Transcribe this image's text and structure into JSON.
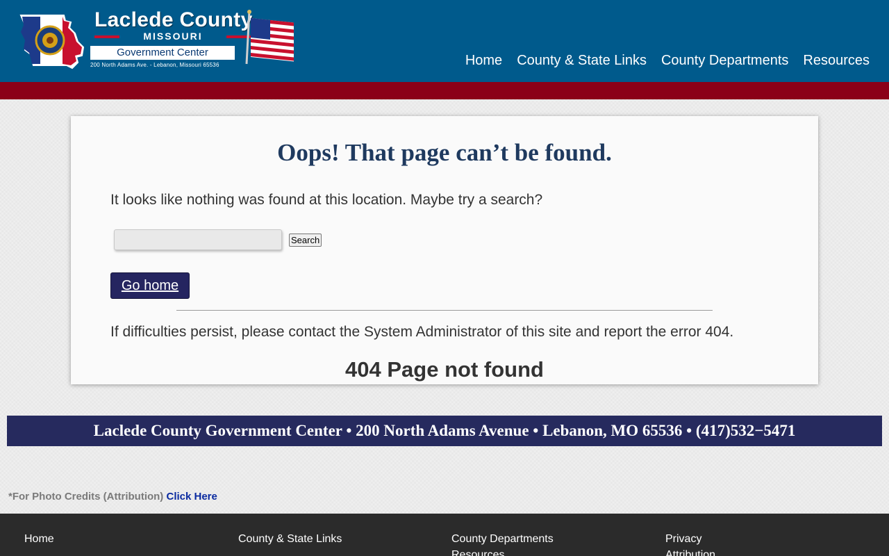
{
  "header": {
    "logo": {
      "title": "Laclede County",
      "state": "MISSOURI",
      "subtitle": "Government Center",
      "address": "200 North Adams Ave. - Lebanon, Missouri 65536"
    },
    "nav": [
      {
        "label": "Home"
      },
      {
        "label": "County & State Links"
      },
      {
        "label": "County Departments"
      },
      {
        "label": "Resources"
      }
    ],
    "colors": {
      "header_bg": "#005a8c",
      "band": "#8b0018"
    }
  },
  "main": {
    "title": "Oops! That page can’t be found.",
    "lead": "It looks like nothing was found at this location. Maybe try a search?",
    "search": {
      "placeholder": "",
      "value": "",
      "button_label": "Search"
    },
    "go_home_label": "Go home",
    "persist_text": "If difficulties persist, please contact the System Administrator of this site and report the error 404.",
    "error_heading": "404 Page not found"
  },
  "address_bar": {
    "text": "Laclede County Government Center • 200 North Adams Avenue • Lebanon, MO 65536 • (417)532−5471"
  },
  "credits": {
    "prefix": "*For Photo Credits (Attribution)",
    "link_label": "Click Here"
  },
  "footer": {
    "links": [
      "Home",
      "County & State Links",
      "County Departments",
      "Resources",
      "Privacy",
      "Attribution"
    ]
  }
}
